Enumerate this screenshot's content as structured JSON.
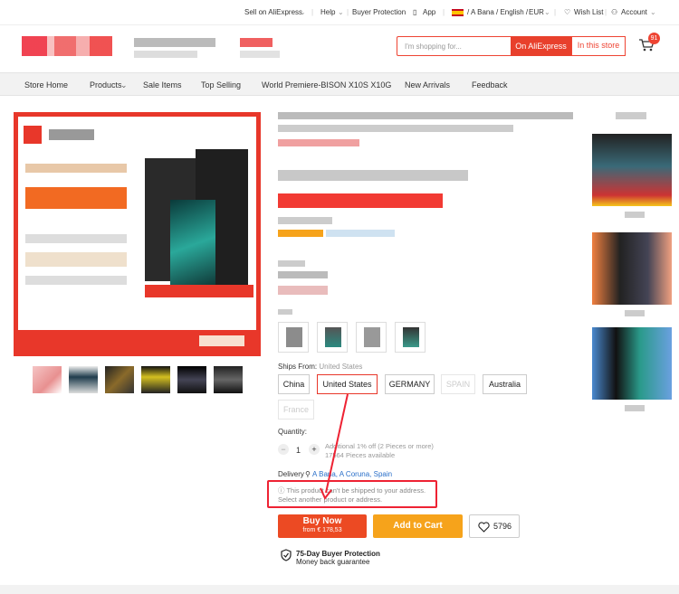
{
  "topbar": {
    "sell": "Sell on AliExpress",
    "help": "Help",
    "protection": "Buyer Protection",
    "app": "App",
    "locale": "/ A Bana / English /",
    "currency": "EUR",
    "wishlist": "Wish List",
    "account": "Account"
  },
  "header": {
    "search_placeholder": "I'm shopping for...",
    "on_aliexpress": "On AliExpress",
    "in_store": "In this store",
    "cart_count": "91"
  },
  "nav": {
    "items": [
      "Store Home",
      "Products",
      "Sale Items",
      "Top Selling",
      "World Premiere-BISON X10S X10G",
      "New Arrivals",
      "Feedback"
    ]
  },
  "ships": {
    "label": "Ships From:",
    "selected": "United States",
    "options": [
      "China",
      "United States",
      "GERMANY",
      "SPAIN",
      "Australia",
      "France"
    ]
  },
  "quantity": {
    "label": "Quantity:",
    "value": "1",
    "discount": "Additional 1% off (2 Pieces or more)",
    "available": "17564 Pieces available"
  },
  "delivery": {
    "label": "Delivery",
    "address": "A Bana, A Coruna, Spain",
    "warning_line1": "This product can't be shipped to your address.",
    "warning_line2": "Select another product or address."
  },
  "actions": {
    "buy_now": "Buy Now",
    "buy_price": "from € 178,53",
    "add_cart": "Add to Cart",
    "wish_count": "5796"
  },
  "protection": {
    "title": "75-Day Buyer Protection",
    "subtitle": "Money back guarantee"
  },
  "colors": {
    "accent": "#e8372a",
    "cart_orange": "#f6a31b"
  }
}
